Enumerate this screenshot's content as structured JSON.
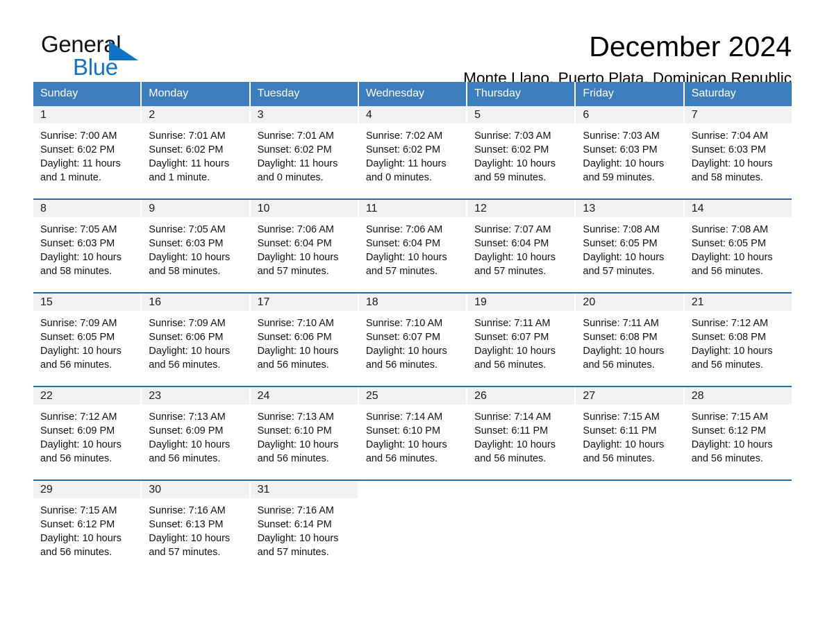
{
  "brand": {
    "name_top": "General",
    "name_bottom": "Blue",
    "triangle_color": "#1273c4"
  },
  "header": {
    "title": "December 2024",
    "subtitle": "Monte Llano, Puerto Plata, Dominican Republic",
    "header_bg_color": "#3b7dbd",
    "row_divider_color": "#2a69ad",
    "daynum_bg_color": "#f1f1f1"
  },
  "weekdays": [
    "Sunday",
    "Monday",
    "Tuesday",
    "Wednesday",
    "Thursday",
    "Friday",
    "Saturday"
  ],
  "weeks": [
    [
      {
        "day": "1",
        "sunrise": "Sunrise: 7:00 AM",
        "sunset": "Sunset: 6:02 PM",
        "daylight": "Daylight: 11 hours and 1 minute."
      },
      {
        "day": "2",
        "sunrise": "Sunrise: 7:01 AM",
        "sunset": "Sunset: 6:02 PM",
        "daylight": "Daylight: 11 hours and 1 minute."
      },
      {
        "day": "3",
        "sunrise": "Sunrise: 7:01 AM",
        "sunset": "Sunset: 6:02 PM",
        "daylight": "Daylight: 11 hours and 0 minutes."
      },
      {
        "day": "4",
        "sunrise": "Sunrise: 7:02 AM",
        "sunset": "Sunset: 6:02 PM",
        "daylight": "Daylight: 11 hours and 0 minutes."
      },
      {
        "day": "5",
        "sunrise": "Sunrise: 7:03 AM",
        "sunset": "Sunset: 6:02 PM",
        "daylight": "Daylight: 10 hours and 59 minutes."
      },
      {
        "day": "6",
        "sunrise": "Sunrise: 7:03 AM",
        "sunset": "Sunset: 6:03 PM",
        "daylight": "Daylight: 10 hours and 59 minutes."
      },
      {
        "day": "7",
        "sunrise": "Sunrise: 7:04 AM",
        "sunset": "Sunset: 6:03 PM",
        "daylight": "Daylight: 10 hours and 58 minutes."
      }
    ],
    [
      {
        "day": "8",
        "sunrise": "Sunrise: 7:05 AM",
        "sunset": "Sunset: 6:03 PM",
        "daylight": "Daylight: 10 hours and 58 minutes."
      },
      {
        "day": "9",
        "sunrise": "Sunrise: 7:05 AM",
        "sunset": "Sunset: 6:03 PM",
        "daylight": "Daylight: 10 hours and 58 minutes."
      },
      {
        "day": "10",
        "sunrise": "Sunrise: 7:06 AM",
        "sunset": "Sunset: 6:04 PM",
        "daylight": "Daylight: 10 hours and 57 minutes."
      },
      {
        "day": "11",
        "sunrise": "Sunrise: 7:06 AM",
        "sunset": "Sunset: 6:04 PM",
        "daylight": "Daylight: 10 hours and 57 minutes."
      },
      {
        "day": "12",
        "sunrise": "Sunrise: 7:07 AM",
        "sunset": "Sunset: 6:04 PM",
        "daylight": "Daylight: 10 hours and 57 minutes."
      },
      {
        "day": "13",
        "sunrise": "Sunrise: 7:08 AM",
        "sunset": "Sunset: 6:05 PM",
        "daylight": "Daylight: 10 hours and 57 minutes."
      },
      {
        "day": "14",
        "sunrise": "Sunrise: 7:08 AM",
        "sunset": "Sunset: 6:05 PM",
        "daylight": "Daylight: 10 hours and 56 minutes."
      }
    ],
    [
      {
        "day": "15",
        "sunrise": "Sunrise: 7:09 AM",
        "sunset": "Sunset: 6:05 PM",
        "daylight": "Daylight: 10 hours and 56 minutes."
      },
      {
        "day": "16",
        "sunrise": "Sunrise: 7:09 AM",
        "sunset": "Sunset: 6:06 PM",
        "daylight": "Daylight: 10 hours and 56 minutes."
      },
      {
        "day": "17",
        "sunrise": "Sunrise: 7:10 AM",
        "sunset": "Sunset: 6:06 PM",
        "daylight": "Daylight: 10 hours and 56 minutes."
      },
      {
        "day": "18",
        "sunrise": "Sunrise: 7:10 AM",
        "sunset": "Sunset: 6:07 PM",
        "daylight": "Daylight: 10 hours and 56 minutes."
      },
      {
        "day": "19",
        "sunrise": "Sunrise: 7:11 AM",
        "sunset": "Sunset: 6:07 PM",
        "daylight": "Daylight: 10 hours and 56 minutes."
      },
      {
        "day": "20",
        "sunrise": "Sunrise: 7:11 AM",
        "sunset": "Sunset: 6:08 PM",
        "daylight": "Daylight: 10 hours and 56 minutes."
      },
      {
        "day": "21",
        "sunrise": "Sunrise: 7:12 AM",
        "sunset": "Sunset: 6:08 PM",
        "daylight": "Daylight: 10 hours and 56 minutes."
      }
    ],
    [
      {
        "day": "22",
        "sunrise": "Sunrise: 7:12 AM",
        "sunset": "Sunset: 6:09 PM",
        "daylight": "Daylight: 10 hours and 56 minutes."
      },
      {
        "day": "23",
        "sunrise": "Sunrise: 7:13 AM",
        "sunset": "Sunset: 6:09 PM",
        "daylight": "Daylight: 10 hours and 56 minutes."
      },
      {
        "day": "24",
        "sunrise": "Sunrise: 7:13 AM",
        "sunset": "Sunset: 6:10 PM",
        "daylight": "Daylight: 10 hours and 56 minutes."
      },
      {
        "day": "25",
        "sunrise": "Sunrise: 7:14 AM",
        "sunset": "Sunset: 6:10 PM",
        "daylight": "Daylight: 10 hours and 56 minutes."
      },
      {
        "day": "26",
        "sunrise": "Sunrise: 7:14 AM",
        "sunset": "Sunset: 6:11 PM",
        "daylight": "Daylight: 10 hours and 56 minutes."
      },
      {
        "day": "27",
        "sunrise": "Sunrise: 7:15 AM",
        "sunset": "Sunset: 6:11 PM",
        "daylight": "Daylight: 10 hours and 56 minutes."
      },
      {
        "day": "28",
        "sunrise": "Sunrise: 7:15 AM",
        "sunset": "Sunset: 6:12 PM",
        "daylight": "Daylight: 10 hours and 56 minutes."
      }
    ],
    [
      {
        "day": "29",
        "sunrise": "Sunrise: 7:15 AM",
        "sunset": "Sunset: 6:12 PM",
        "daylight": "Daylight: 10 hours and 56 minutes."
      },
      {
        "day": "30",
        "sunrise": "Sunrise: 7:16 AM",
        "sunset": "Sunset: 6:13 PM",
        "daylight": "Daylight: 10 hours and 57 minutes."
      },
      {
        "day": "31",
        "sunrise": "Sunrise: 7:16 AM",
        "sunset": "Sunset: 6:14 PM",
        "daylight": "Daylight: 10 hours and 57 minutes."
      },
      {
        "day": "",
        "sunrise": "",
        "sunset": "",
        "daylight": ""
      },
      {
        "day": "",
        "sunrise": "",
        "sunset": "",
        "daylight": ""
      },
      {
        "day": "",
        "sunrise": "",
        "sunset": "",
        "daylight": ""
      },
      {
        "day": "",
        "sunrise": "",
        "sunset": "",
        "daylight": ""
      }
    ]
  ]
}
